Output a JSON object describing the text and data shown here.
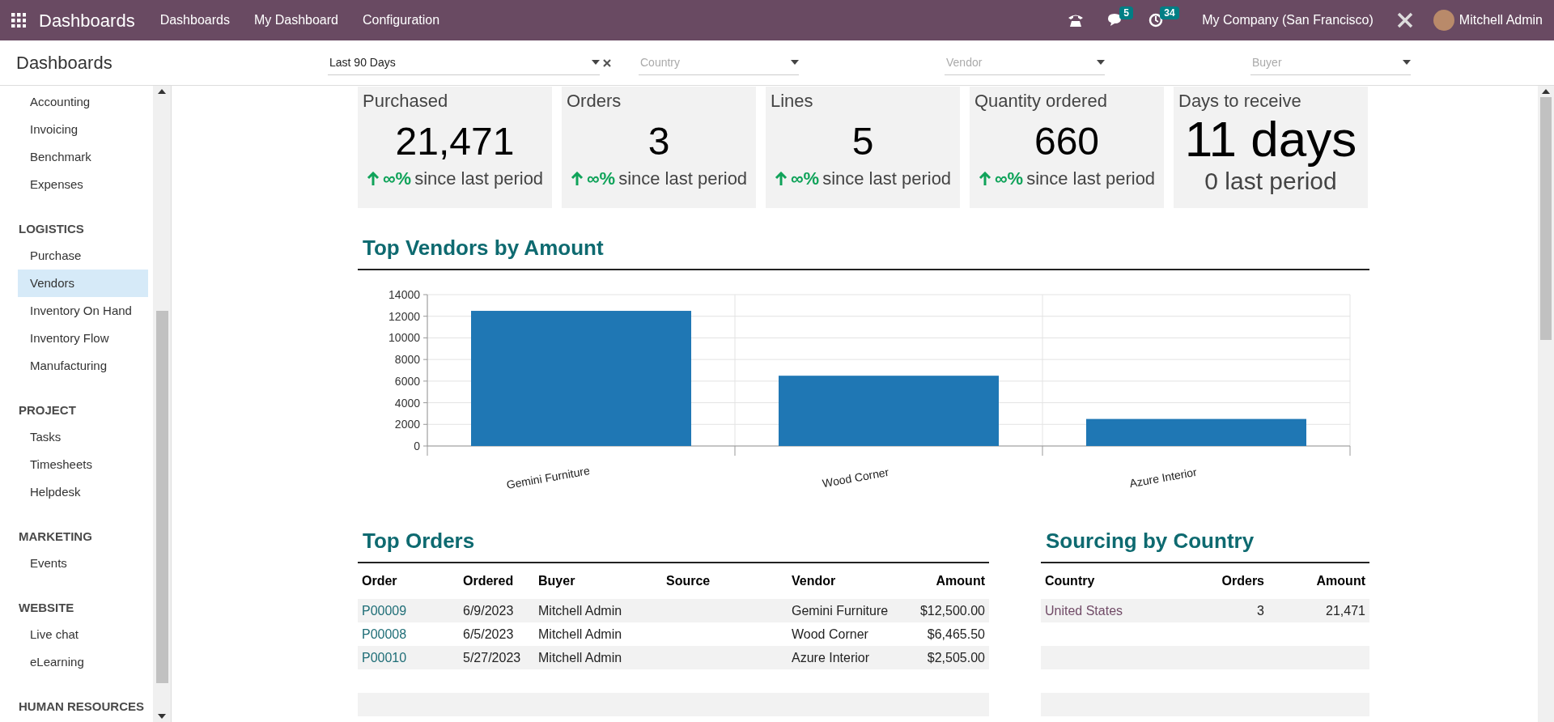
{
  "topbar": {
    "app_title": "Dashboards",
    "menu": [
      "Dashboards",
      "My Dashboard",
      "Configuration"
    ],
    "chat_count": "5",
    "activity_count": "34",
    "company": "My Company (San Francisco)",
    "user": "Mitchell Admin"
  },
  "header": {
    "title": "Dashboards",
    "filters": [
      {
        "value": "Last 90 Days"
      },
      {
        "placeholder": "Country"
      },
      {
        "placeholder": "Vendor"
      },
      {
        "placeholder": "Buyer"
      }
    ]
  },
  "sidebar": {
    "sections": [
      {
        "items": [
          {
            "label": "Accounting",
            "selected": false
          },
          {
            "label": "Invoicing",
            "selected": false
          },
          {
            "label": "Benchmark",
            "selected": false
          },
          {
            "label": "Expenses",
            "selected": false
          }
        ]
      },
      {
        "title": "LOGISTICS",
        "items": [
          {
            "label": "Purchase",
            "selected": false
          },
          {
            "label": "Vendors",
            "selected": true
          },
          {
            "label": "Inventory On Hand",
            "selected": false
          },
          {
            "label": "Inventory Flow",
            "selected": false
          },
          {
            "label": "Manufacturing",
            "selected": false
          }
        ]
      },
      {
        "title": "PROJECT",
        "items": [
          {
            "label": "Tasks",
            "selected": false
          },
          {
            "label": "Timesheets",
            "selected": false
          },
          {
            "label": "Helpdesk",
            "selected": false
          }
        ]
      },
      {
        "title": "MARKETING",
        "items": [
          {
            "label": "Events",
            "selected": false
          }
        ]
      },
      {
        "title": "WEBSITE",
        "items": [
          {
            "label": "Live chat",
            "selected": false
          },
          {
            "label": "eLearning",
            "selected": false
          }
        ]
      },
      {
        "title": "HUMAN RESOURCES"
      }
    ]
  },
  "kpis": [
    {
      "kind": "trend",
      "title": "Purchased",
      "value": "21,471",
      "change": "∞%",
      "note": "since last period"
    },
    {
      "kind": "trend",
      "title": "Orders",
      "value": "3",
      "change": "∞%",
      "note": "since last period"
    },
    {
      "kind": "trend",
      "title": "Lines",
      "value": "5",
      "change": "∞%",
      "note": "since last period"
    },
    {
      "kind": "trend",
      "title": "Quantity ordered",
      "value": "660",
      "change": "∞%",
      "note": "since last period"
    },
    {
      "kind": "comparison",
      "title": "Days to receive",
      "value": "11 days",
      "note": "0 last period"
    }
  ],
  "vendors_chart": {
    "title": "Top Vendors by Amount",
    "chart_data": {
      "type": "bar",
      "categories": [
        "Gemini Furniture",
        "Wood Corner",
        "Azure Interior"
      ],
      "series": [
        {
          "color": "#1f77b4",
          "values": [
            12500,
            6500,
            2500
          ]
        }
      ],
      "grid": true,
      "ylim": [
        0,
        14000
      ],
      "yticks": [
        0,
        2000,
        4000,
        6000,
        8000,
        10000,
        12000,
        14000
      ]
    }
  },
  "top_orders": {
    "title": "Top Orders",
    "columns": [
      "Order",
      "Ordered",
      "Buyer",
      "Source",
      "Vendor",
      "Amount"
    ],
    "rows": [
      [
        "P00009",
        "6/9/2023",
        "Mitchell Admin",
        "",
        "Gemini Furniture",
        "$12,500.00"
      ],
      [
        "P00008",
        "6/5/2023",
        "Mitchell Admin",
        "",
        "Wood Corner",
        "$6,465.50"
      ],
      [
        "P00010",
        "5/27/2023",
        "Mitchell Admin",
        "",
        "Azure Interior",
        "$2,505.00"
      ]
    ]
  },
  "sourcing": {
    "title": "Sourcing by Country",
    "columns": [
      "Country",
      "Orders",
      "Amount"
    ],
    "rows": [
      [
        "United States",
        "3",
        "21,471"
      ]
    ]
  }
}
